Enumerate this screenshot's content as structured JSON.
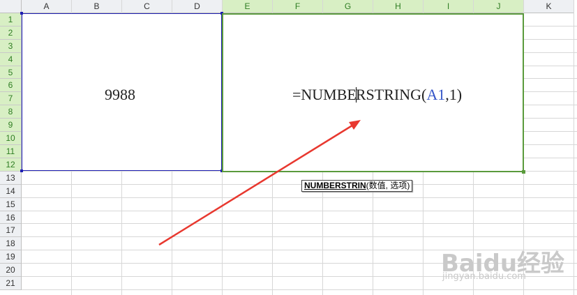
{
  "columns": [
    "A",
    "B",
    "C",
    "D",
    "E",
    "F",
    "G",
    "H",
    "I",
    "J",
    "K"
  ],
  "rows": [
    "1",
    "2",
    "3",
    "4",
    "5",
    "6",
    "7",
    "8",
    "9",
    "10",
    "11",
    "12",
    "13",
    "14",
    "15",
    "16",
    "17",
    "18",
    "19",
    "20",
    "21"
  ],
  "cell_left": {
    "value": "9988"
  },
  "cell_right": {
    "formula_prefix": "=NUMBE",
    "formula_middle": "RSTRING(",
    "formula_ref": "A1",
    "formula_suffix": ",1)"
  },
  "tooltip": {
    "function_name": "NUMBERSTRIN",
    "args": "(数值, 选项)"
  },
  "watermark": {
    "text": "Baidu经验",
    "url_text": "jingyan.baidu.com"
  },
  "colors": {
    "selection_blue": "#1f1fb3",
    "selection_green": "#5a9a3c",
    "arrow_red": "#e8382f",
    "ref_blue": "#3455c8"
  }
}
